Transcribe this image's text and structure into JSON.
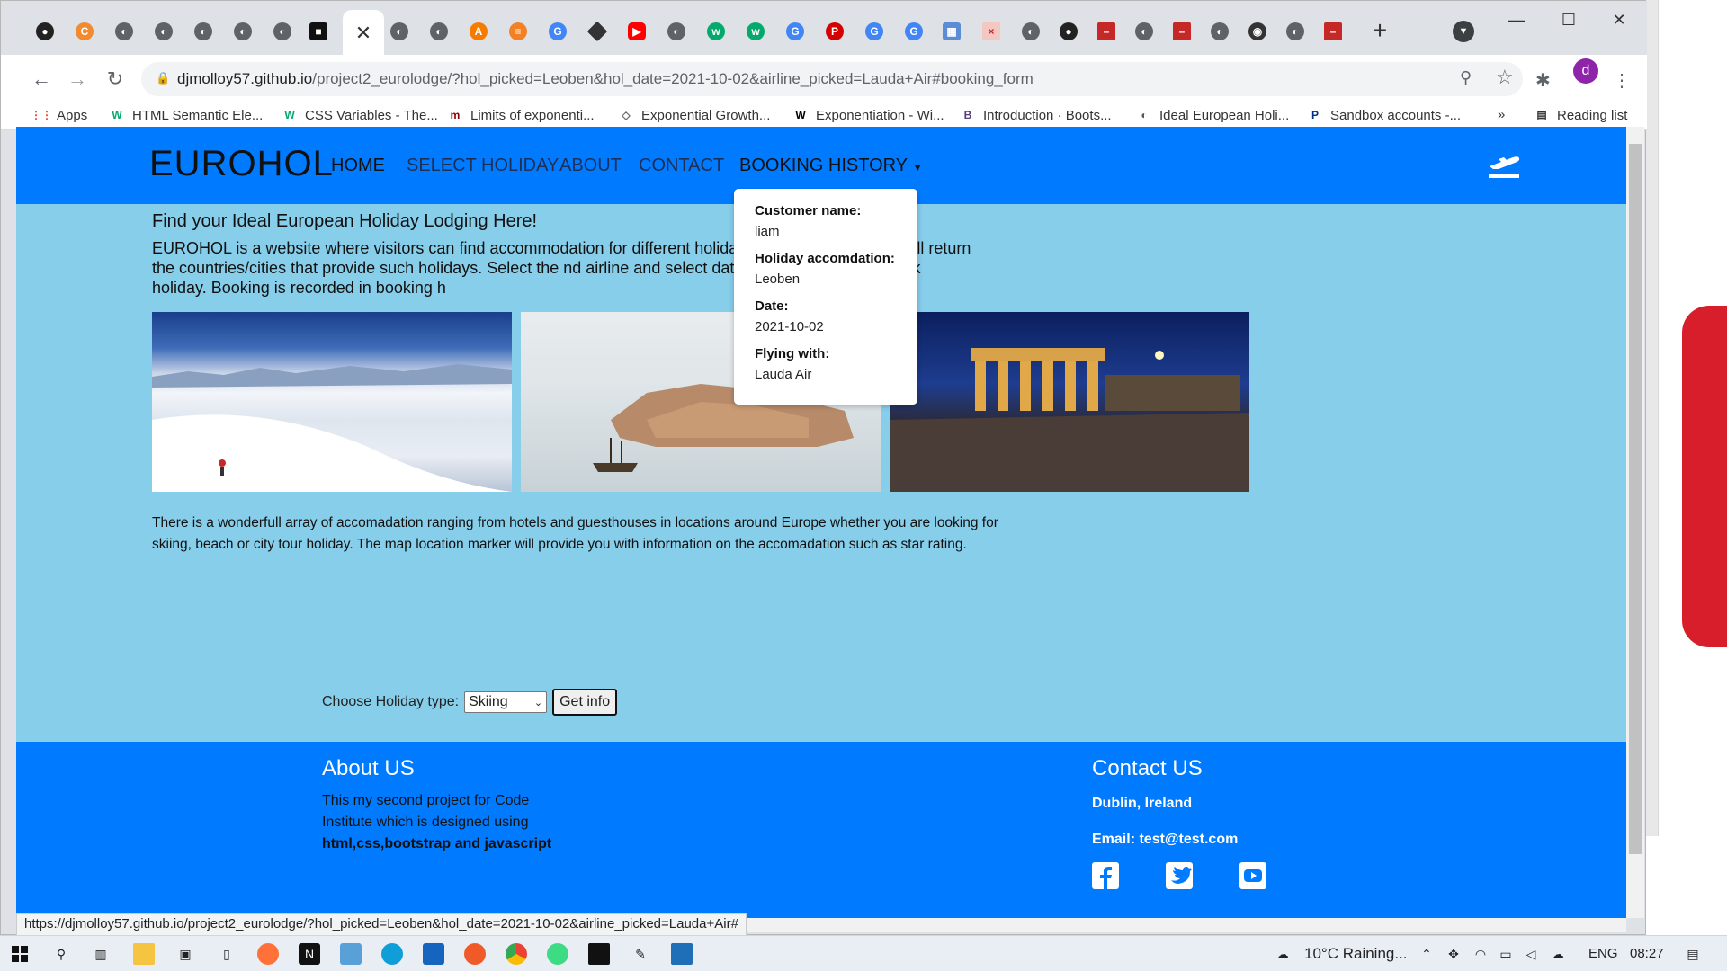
{
  "browser": {
    "url_host": "djmolloy57.github.io",
    "url_path": "/project2_eurolodge/?hol_picked=Leoben&hol_date=2021-10-02&airline_picked=Lauda+Air#booking_form",
    "profile_initial": "d",
    "status_url": "https://djmolloy57.github.io/project2_eurolodge/?hol_picked=Leoben&hol_date=2021-10-02&airline_picked=Lauda+Air#"
  },
  "bookmarks": [
    {
      "label": "Apps",
      "icon": "apps-grid-icon",
      "color": "#ea4335"
    },
    {
      "label": "HTML Semantic Ele...",
      "icon": "w3schools-icon",
      "color": "#04aa6d"
    },
    {
      "label": "CSS Variables - The...",
      "icon": "w3schools-icon",
      "color": "#04aa6d"
    },
    {
      "label": "Limits of exponenti...",
      "icon": "mathisfun-icon",
      "color": "#8b0000"
    },
    {
      "label": "Exponential Growth...",
      "icon": "book-icon",
      "color": "#666666"
    },
    {
      "label": "Exponentiation - Wi...",
      "icon": "wikipedia-icon",
      "color": "#000000"
    },
    {
      "label": "Introduction · Boots...",
      "icon": "bootstrap-icon",
      "color": "#563d7c"
    },
    {
      "label": "Ideal European Holi...",
      "icon": "globe-icon",
      "color": "#555555"
    },
    {
      "label": "Sandbox accounts -...",
      "icon": "paypal-icon",
      "color": "#003087"
    }
  ],
  "bookmarks_more": "»",
  "reading_list": "Reading list",
  "site": {
    "brand": "EUROHOL",
    "nav": {
      "home": "HOME",
      "select_holiday": "SELECT HOLIDAY",
      "about": "ABOUT",
      "contact": "CONTACT",
      "booking_history": "BOOKING HISTORY"
    },
    "booking": {
      "customer_label": "Customer name:",
      "customer": "liam",
      "accom_label": "Holiday accomdation:",
      "accom": "Leoben",
      "date_label": "Date:",
      "date": "2021-10-02",
      "flying_label": "Flying with:",
      "flying": "Lauda Air"
    },
    "intro_heading": "Find your Ideal European Holiday Lodging Here!",
    "intro_text": "EUROHOL is a website where visitors can find accommodation for different holida d skiing holiday and it will return the countries/cities that provide such holidays. Select the nd airline and select date and click submit to book holiday. Booking is recorded in booking h",
    "body_text": "There is a wonderfull array of accomadation ranging from hotels and guesthouses in locations around Europe whether you are looking for skiing, beach or city tour holiday. The map location marker will provide you with information on the accomadation such as star rating.",
    "form": {
      "label": "Choose Holiday type:",
      "selected": "Skiing",
      "button": "Get info"
    },
    "footer": {
      "about_heading": "About US",
      "about_text": "This my second project for Code Institute which is designed using",
      "about_bold": "html,css,bootstrap and javascript",
      "contact_heading": "Contact US",
      "city": "Dublin, Ireland",
      "email": "Email: test@test.com"
    }
  },
  "taskbar": {
    "weather": "10°C  Raining...",
    "lang": "ENG",
    "time": "08:27"
  },
  "colors": {
    "navbar": "#007bff",
    "page_bg": "#87ceeb",
    "footer": "#007bff"
  }
}
